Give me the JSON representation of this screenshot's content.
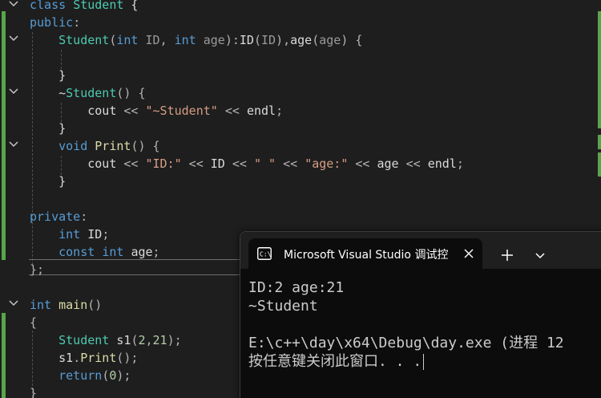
{
  "editor": {
    "lines": [
      [
        [
          "kw",
          "class"
        ],
        [
          "id",
          " "
        ],
        [
          "type",
          "Student"
        ],
        [
          "id",
          " {"
        ]
      ],
      [
        [
          "kw",
          "public"
        ],
        [
          "punc",
          ":"
        ]
      ],
      [
        [
          "id",
          "    "
        ],
        [
          "type",
          "Student"
        ],
        [
          "punc",
          "("
        ],
        [
          "kw",
          "int"
        ],
        [
          "id",
          " "
        ],
        [
          "param",
          "ID"
        ],
        [
          "punc",
          ", "
        ],
        [
          "kw",
          "int"
        ],
        [
          "id",
          " "
        ],
        [
          "param",
          "age"
        ],
        [
          "punc",
          "):"
        ],
        [
          "var",
          "ID"
        ],
        [
          "punc",
          "("
        ],
        [
          "param",
          "ID"
        ],
        [
          "punc",
          "),"
        ],
        [
          "var",
          "age"
        ],
        [
          "punc",
          "("
        ],
        [
          "param",
          "age"
        ],
        [
          "punc",
          ") {"
        ]
      ],
      [
        [
          "id",
          ""
        ]
      ],
      [
        [
          "id",
          "    }"
        ]
      ],
      [
        [
          "id",
          "    ~"
        ],
        [
          "type",
          "Student"
        ],
        [
          "punc",
          "() {"
        ]
      ],
      [
        [
          "id",
          "        "
        ],
        [
          "var",
          "cout"
        ],
        [
          "punc",
          " << "
        ],
        [
          "str",
          "\"~Student\""
        ],
        [
          "punc",
          " << "
        ],
        [
          "var",
          "endl"
        ],
        [
          "punc",
          ";"
        ]
      ],
      [
        [
          "id",
          "    }"
        ]
      ],
      [
        [
          "id",
          "    "
        ],
        [
          "kw",
          "void"
        ],
        [
          "id",
          " "
        ],
        [
          "fn",
          "Print"
        ],
        [
          "punc",
          "() {"
        ]
      ],
      [
        [
          "id",
          "        "
        ],
        [
          "var",
          "cout"
        ],
        [
          "punc",
          " << "
        ],
        [
          "str",
          "\"ID:\""
        ],
        [
          "punc",
          " << "
        ],
        [
          "var",
          "ID"
        ],
        [
          "punc",
          " << "
        ],
        [
          "str",
          "\" \""
        ],
        [
          "punc",
          " << "
        ],
        [
          "str",
          "\"age:\""
        ],
        [
          "punc",
          " << "
        ],
        [
          "var",
          "age"
        ],
        [
          "punc",
          " << "
        ],
        [
          "var",
          "endl"
        ],
        [
          "punc",
          ";"
        ]
      ],
      [
        [
          "id",
          "    }"
        ]
      ],
      [
        [
          "id",
          ""
        ]
      ],
      [
        [
          "kw",
          "private"
        ],
        [
          "punc",
          ":"
        ]
      ],
      [
        [
          "id",
          "    "
        ],
        [
          "kw",
          "int"
        ],
        [
          "id",
          " "
        ],
        [
          "var",
          "ID"
        ],
        [
          "punc",
          ";"
        ]
      ],
      [
        [
          "id",
          "    "
        ],
        [
          "kw",
          "const"
        ],
        [
          "id",
          " "
        ],
        [
          "kw",
          "int"
        ],
        [
          "id",
          " "
        ],
        [
          "var",
          "age"
        ],
        [
          "punc",
          ";"
        ]
      ],
      [
        [
          "punc",
          "};"
        ]
      ],
      [
        [
          "id",
          ""
        ]
      ],
      [
        [
          "kw",
          "int"
        ],
        [
          "id",
          " "
        ],
        [
          "fn",
          "main"
        ],
        [
          "punc",
          "()"
        ]
      ],
      [
        [
          "punc",
          "{"
        ]
      ],
      [
        [
          "id",
          "    "
        ],
        [
          "type",
          "Student"
        ],
        [
          "id",
          " "
        ],
        [
          "var",
          "s1"
        ],
        [
          "punc",
          "("
        ],
        [
          "num",
          "2"
        ],
        [
          "punc",
          ","
        ],
        [
          "num",
          "21"
        ],
        [
          "punc",
          ");"
        ]
      ],
      [
        [
          "id",
          "    "
        ],
        [
          "var",
          "s1"
        ],
        [
          "punc",
          "."
        ],
        [
          "fn",
          "Print"
        ],
        [
          "punc",
          "();"
        ]
      ],
      [
        [
          "id",
          "    "
        ],
        [
          "kw",
          "return"
        ],
        [
          "punc",
          "("
        ],
        [
          "num",
          "0"
        ],
        [
          "punc",
          ");"
        ]
      ],
      [
        [
          "punc",
          "}"
        ]
      ]
    ],
    "colors": {
      "keyword": "#569cd6",
      "type": "#4ec9b0",
      "function": "#dcdcaa",
      "string": "#d69d85",
      "number": "#b5cea8",
      "change_bar": "#57a64a",
      "background": "#1e1e1e"
    },
    "fold_icon": "chevron-down-icon"
  },
  "console": {
    "tab_title": "Microsoft Visual Studio 调试控",
    "tab_icon": "terminal-icon",
    "close_icon": "close-icon",
    "new_tab_icon": "plus-icon",
    "dropdown_icon": "chevron-down-icon",
    "output": [
      "ID:2 age:21",
      "~Student",
      "",
      "E:\\c++\\day\\x64\\Debug\\day.exe (进程 12",
      "按任意键关闭此窗口. . ."
    ],
    "colors": {
      "background": "#0c0c0c",
      "titlebar": "#1f1f1f",
      "text": "#cccccc"
    }
  }
}
